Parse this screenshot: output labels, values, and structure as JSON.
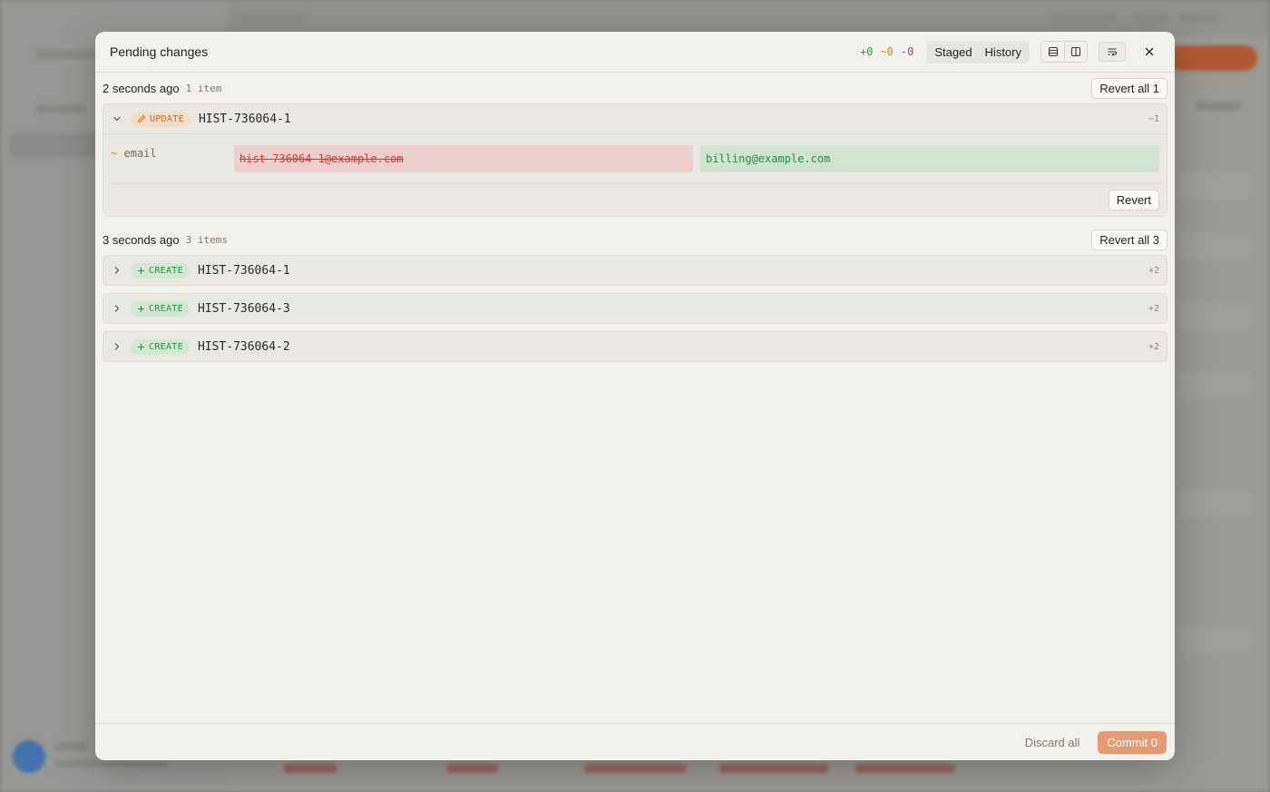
{
  "modal": {
    "title": "Pending changes",
    "counts": {
      "added": "+0",
      "modified": "~0",
      "deleted": "-0"
    },
    "tabs": [
      {
        "label": "Staged"
      },
      {
        "label": "History"
      }
    ],
    "groups": [
      {
        "time": "2 seconds ago",
        "count": "1 item",
        "revert_all": "Revert all 1",
        "items": [
          {
            "badge": "UPDATE",
            "id": "HIST-736064-1",
            "delta": "~1",
            "field": "email",
            "old_value": "hist-736064-1@example.com",
            "new_value": "billing@example.com",
            "revert": "Revert"
          }
        ]
      },
      {
        "time": "3 seconds ago",
        "count": "3 items",
        "revert_all": "Revert all 3",
        "items": [
          {
            "badge": "CREATE",
            "id": "HIST-736064-1",
            "delta": "+2"
          },
          {
            "badge": "CREATE",
            "id": "HIST-736064-3",
            "delta": "+2"
          },
          {
            "badge": "CREATE",
            "id": "HIST-736064-2",
            "delta": "+2"
          }
        ]
      }
    ],
    "footer": {
      "discard": "Discard all",
      "commit": "Commit 0"
    }
  },
  "icons": {
    "view_list": "rows-icon",
    "view_split": "columns-icon",
    "wrap": "wrap-text-icon",
    "close": "close-icon",
    "pencil": "pencil-icon",
    "plus": "plus-icon",
    "chevron_down": "chevron-down-icon",
    "chevron_right": "chevron-right-icon"
  },
  "colors": {
    "added": "#2f9a4b",
    "modified": "#d9862b",
    "deleted": "#d3403a",
    "commit": "#e59a74"
  }
}
